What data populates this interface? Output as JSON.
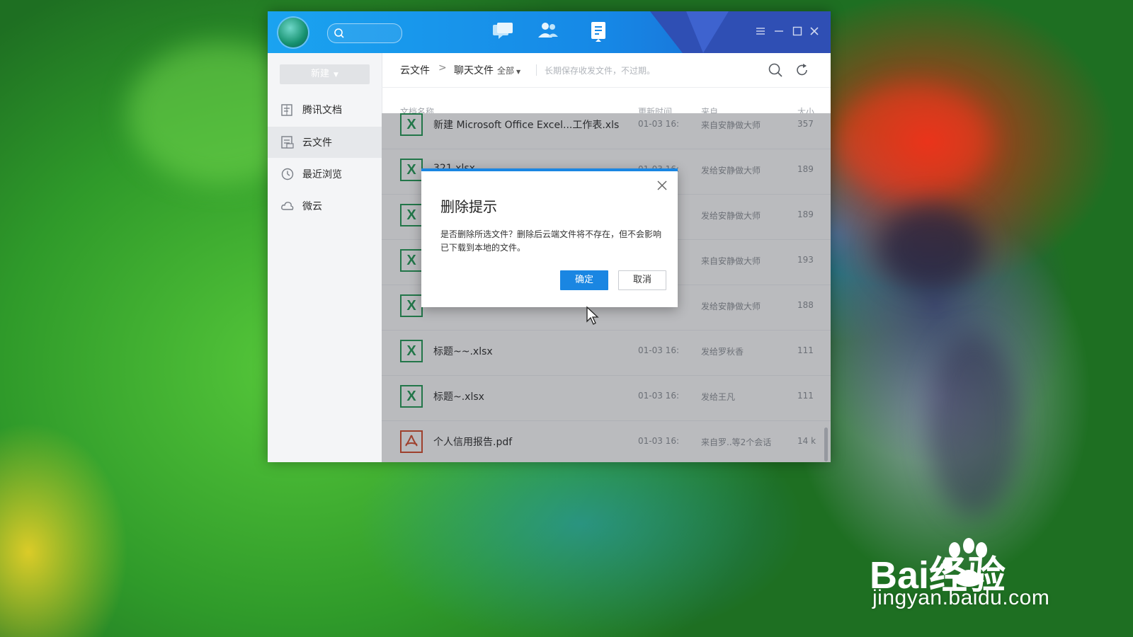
{
  "window": {
    "new_button_label": "新建",
    "sidebar": {
      "items": [
        {
          "label": "腾讯文档"
        },
        {
          "label": "云文件"
        },
        {
          "label": "最近浏览"
        },
        {
          "label": "微云"
        }
      ]
    },
    "breadcrumb": {
      "root": "云文件",
      "separator": ">",
      "current": "聊天文件",
      "filter": "全部",
      "hint": "长期保存收发文件，不过期。"
    },
    "columns": {
      "name": "文档名称",
      "time": "更新时间",
      "from": "来自",
      "size": "大小"
    },
    "files": [
      {
        "icon": "X",
        "name": "新建 Microsoft Office Excel...工作表.xls",
        "time": "01-03 16:",
        "from": "来自安静做大师",
        "size": "357"
      },
      {
        "icon": "X",
        "name": "321.xlsx",
        "time": "01-03 16:",
        "from": "发给安静做大师",
        "size": "189"
      },
      {
        "icon": "X",
        "name": "",
        "time": "",
        "from": "发给安静做大师",
        "size": "189"
      },
      {
        "icon": "X",
        "name": "",
        "time": "",
        "from": "来自安静做大师",
        "size": "193"
      },
      {
        "icon": "X",
        "name": "",
        "time": "",
        "from": "发给安静做大师",
        "size": "188"
      },
      {
        "icon": "X",
        "name": "标题~~.xlsx",
        "time": "01-03 16:",
        "from": "发给罗秋香",
        "size": "111"
      },
      {
        "icon": "X",
        "name": "标题~.xlsx",
        "time": "01-03 16:",
        "from": "发给王凡",
        "size": "111"
      },
      {
        "icon": "pdf",
        "name": "个人信用报告.pdf",
        "time": "01-03 16:",
        "from": "来自罗..等2个会话",
        "size": "14 k"
      }
    ]
  },
  "dialog": {
    "title": "删除提示",
    "message": "是否删除所选文件？删除后云端文件将不存在，但不会影响已下载到本地的文件。",
    "confirm_label": "确定",
    "cancel_label": "取消"
  },
  "watermark": {
    "brand": "Bai经验",
    "url": "jingyan.baidu.com"
  },
  "colors": {
    "accent": "#1a86e2",
    "titlebar": "#1688e6",
    "excel_green": "#1f9a53",
    "pdf_red": "#d64a2a"
  }
}
